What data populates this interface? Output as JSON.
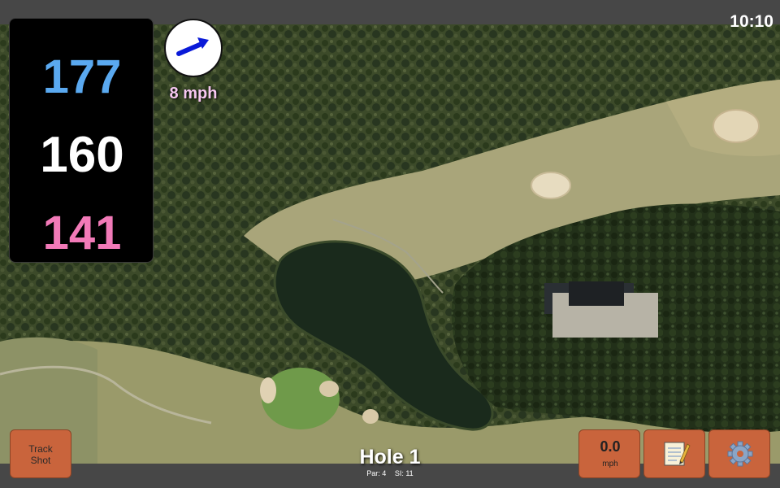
{
  "status_bar": {
    "time": "10:10"
  },
  "distances": {
    "back": "177",
    "middle": "160",
    "front": "141"
  },
  "wind": {
    "speed": "8 mph",
    "icon": "wind-direction-arrow-icon"
  },
  "buttons": {
    "track_shot_line1": "Track",
    "track_shot_line2": "Shot",
    "speed_value": "0.0",
    "speed_unit": "mph",
    "notes_icon": "notepad-icon",
    "settings_icon": "gear-icon"
  },
  "hole": {
    "title": "Hole 1",
    "par": "Par: 4",
    "stroke_index": "SI: 11"
  },
  "colors": {
    "back_distance": "#5aa9f0",
    "middle_distance": "#ffffff",
    "front_distance": "#f27ab8",
    "button_bg": "#c9643c",
    "wind_arrow": "#0a1ad8"
  }
}
